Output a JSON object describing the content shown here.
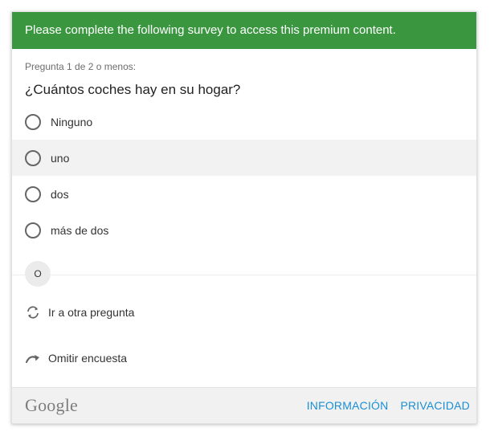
{
  "banner": {
    "text": "Please complete the following survey to access this premium content."
  },
  "question": {
    "count": "Pregunta 1 de 2 o menos:",
    "text": "¿Cuántos coches hay en su hogar?",
    "answers": [
      {
        "label": "Ninguno"
      },
      {
        "label": "uno"
      },
      {
        "label": "dos"
      },
      {
        "label": "más de dos"
      }
    ]
  },
  "separator": {
    "or_label": "O"
  },
  "actions": {
    "next_question": "Ir a otra pregunta",
    "skip_survey": "Omitir encuesta"
  },
  "footer": {
    "brand": "Google",
    "info_link": "INFORMACIÓN",
    "privacy_link": "PRIVACIDAD"
  },
  "colors": {
    "banner_bg": "#3a9740",
    "link": "#1a8fd6",
    "hover_row": "#f2f2f2"
  },
  "icons": {
    "next_question": "refresh-arrows-icon",
    "skip_survey": "curved-arrow-icon"
  }
}
